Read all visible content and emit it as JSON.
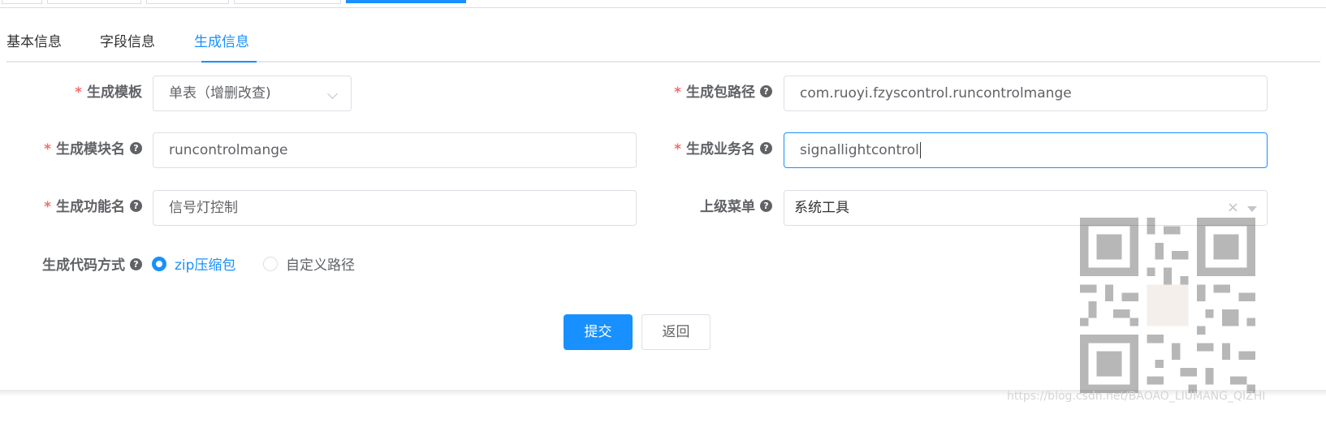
{
  "tabs": [
    {
      "label": "基本信息"
    },
    {
      "label": "字段信息"
    },
    {
      "label": "生成信息"
    }
  ],
  "form": {
    "tpl": {
      "label": "生成模板",
      "value": "单表（增删改查)"
    },
    "package": {
      "label": "生成包路径",
      "value": "com.ruoyi.fzyscontrol.runcontrolmange"
    },
    "module": {
      "label": "生成模块名",
      "value": "runcontrolmange"
    },
    "business": {
      "label": "生成业务名",
      "value": "signallightcontrol"
    },
    "function": {
      "label": "生成功能名",
      "value": "信号灯控制"
    },
    "parent_menu": {
      "label": "上级菜单",
      "value": "系统工具"
    },
    "gen_type": {
      "label": "生成代码方式",
      "options": [
        "zip压缩包",
        "自定义路径"
      ],
      "selected": "zip压缩包"
    }
  },
  "buttons": {
    "submit": "提交",
    "back": "返回"
  },
  "icons": {
    "help": "?",
    "clear": "×"
  },
  "watermark": "https://blog.csdn.net/BAOAO_LIUMANG_QIZHI",
  "colors": {
    "primary": "#1890ff",
    "required": "#f56c6c",
    "label": "#606266"
  }
}
